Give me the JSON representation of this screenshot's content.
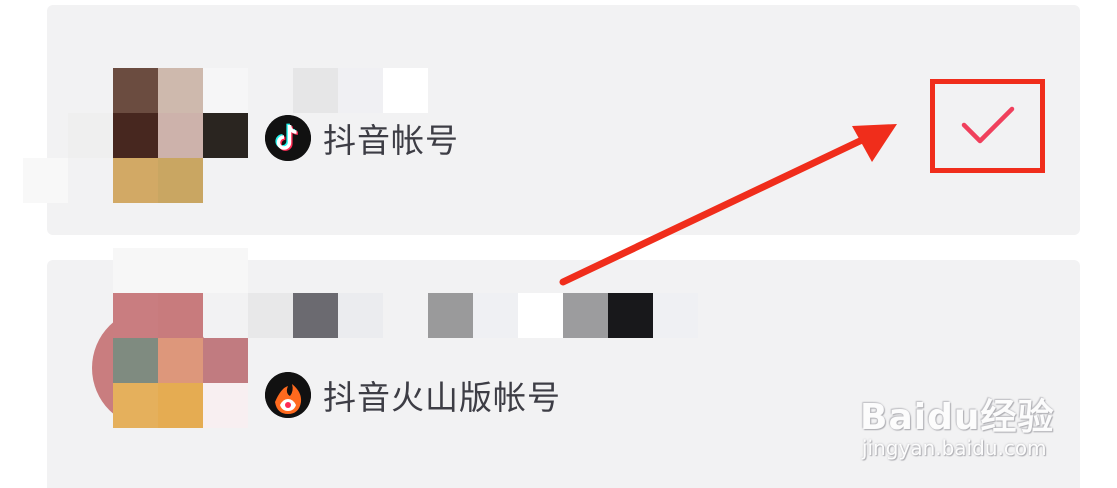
{
  "accounts": [
    {
      "app_label": "抖音帐号",
      "logo": "tiktok-logo-icon",
      "selected": true
    },
    {
      "app_label": "抖音火山版帐号",
      "logo": "huoshan-logo-icon",
      "selected": false
    }
  ],
  "selection": {
    "icon": "checkmark-icon",
    "check_color": "#f0405c"
  },
  "annotation": {
    "color": "#f02d1b"
  },
  "watermark": {
    "brand": "Baidu经验",
    "domain": "jingyan.baidu.com"
  },
  "colors": {
    "card_background": "#f2f2f3",
    "label_text": "#3d3d45"
  }
}
